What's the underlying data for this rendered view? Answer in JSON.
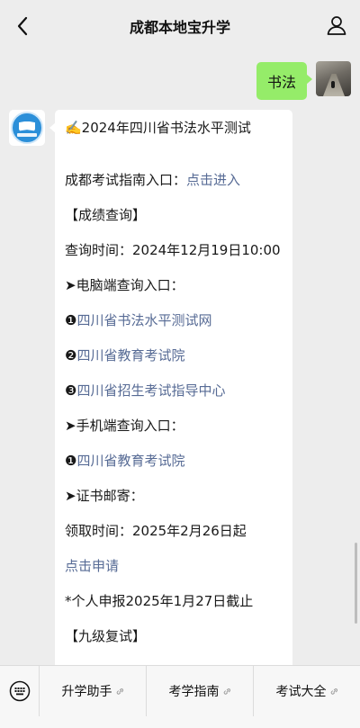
{
  "header": {
    "title": "成都本地宝升学"
  },
  "outgoing": {
    "text": "书法"
  },
  "message": {
    "lines": [
      {
        "parts": [
          {
            "text": "✍️2024年四川省书法水平测试",
            "link": false
          }
        ]
      },
      {
        "parts": [
          {
            "text": "成都考试指南入口：",
            "link": false
          },
          {
            "text": "点击进入",
            "link": true
          }
        ]
      },
      {
        "parts": [
          {
            "text": "【成绩查询】",
            "link": false
          }
        ]
      },
      {
        "parts": [
          {
            "text": "查询时间：2024年12月19日10:00",
            "link": false
          }
        ]
      },
      {
        "parts": [
          {
            "text": "➤电脑端查询入口：",
            "link": false
          }
        ]
      },
      {
        "parts": [
          {
            "text": "❶",
            "link": false
          },
          {
            "text": "四川省书法水平测试网",
            "link": true
          }
        ]
      },
      {
        "parts": [
          {
            "text": "❷",
            "link": false
          },
          {
            "text": "四川省教育考试院",
            "link": true
          }
        ]
      },
      {
        "parts": [
          {
            "text": "❸",
            "link": false
          },
          {
            "text": "四川省招生考试指导中心",
            "link": true
          }
        ]
      },
      {
        "parts": [
          {
            "text": "➤手机端查询入口：",
            "link": false
          }
        ]
      },
      {
        "parts": [
          {
            "text": "❶",
            "link": false
          },
          {
            "text": "四川省教育考试院",
            "link": true
          }
        ]
      },
      {
        "parts": [
          {
            "text": "➤证书邮寄：",
            "link": false
          }
        ]
      },
      {
        "parts": [
          {
            "text": "领取时间：2025年2月26日起",
            "link": false
          }
        ]
      },
      {
        "parts": [
          {
            "text": "点击申请",
            "link": true
          }
        ]
      },
      {
        "parts": [
          {
            "text": "*个人申报2025年1月27日截止",
            "link": false
          }
        ]
      },
      {
        "parts": [
          {
            "text": "【九级复试】",
            "link": false
          }
        ]
      }
    ]
  },
  "bottom_menu": [
    {
      "label": "升学助手"
    },
    {
      "label": "考学指南"
    },
    {
      "label": "考试大全"
    }
  ],
  "colors": {
    "background": "#ededed",
    "outgoing_bubble": "#95ec69",
    "link": "#576b95",
    "avatar_blue": "#2b8fd9"
  },
  "icons": {
    "back": "chevron-left-icon",
    "profile": "person-icon",
    "keyboard": "keyboard-icon",
    "menu_link": "link-icon"
  }
}
